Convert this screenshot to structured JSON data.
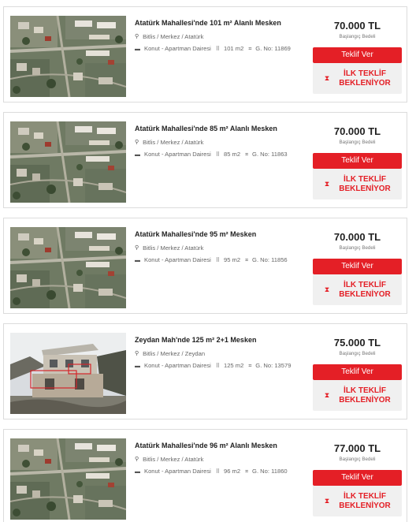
{
  "listings": [
    {
      "title": "Atatürk Mahallesi'nde 101 m² Alanlı Mesken",
      "location": "Bitlis / Merkez / Atatürk",
      "type": "Konut - Apartman Dairesi",
      "area": "101 m2",
      "gno": "G. No: 11869",
      "price": "70.000 TL",
      "price_label": "Başlangıç Bedeli",
      "bid_label": "Teklif Ver",
      "status": "İLK TEKLİF BEKLENİYOR",
      "image_kind": "aerial"
    },
    {
      "title": "Atatürk Mahallesi'nde 85 m² Alanlı Mesken",
      "location": "Bitlis / Merkez / Atatürk",
      "type": "Konut - Apartman Dairesi",
      "area": "85 m2",
      "gno": "G. No: 11863",
      "price": "70.000 TL",
      "price_label": "Başlangıç Bedeli",
      "bid_label": "Teklif Ver",
      "status": "İLK TEKLİF BEKLENİYOR",
      "image_kind": "aerial"
    },
    {
      "title": "Atatürk Mahallesi'nde 95 m² Mesken",
      "location": "Bitlis / Merkez / Atatürk",
      "type": "Konut - Apartman Dairesi",
      "area": "95 m2",
      "gno": "G. No: 11856",
      "price": "70.000 TL",
      "price_label": "Başlangıç Bedeli",
      "bid_label": "Teklif Ver",
      "status": "İLK TEKLİF BEKLENİYOR",
      "image_kind": "aerial"
    },
    {
      "title": "Zeydan Mah'nde 125 m² 2+1 Mesken",
      "location": "Bitlis / Merkez / Zeydan",
      "type": "Konut - Apartman Dairesi",
      "area": "125 m2",
      "gno": "G. No: 13579",
      "price": "75.000 TL",
      "price_label": "Başlangıç Bedeli",
      "bid_label": "Teklif Ver",
      "status": "İLK TEKLİF BEKLENİYOR",
      "image_kind": "house"
    },
    {
      "title": "Atatürk Mahallesi'nde 96 m² Alanlı Mesken",
      "location": "Bitlis / Merkez / Atatürk",
      "type": "Konut - Apartman Dairesi",
      "area": "96 m2",
      "gno": "G. No: 11860",
      "price": "77.000 TL",
      "price_label": "Başlangıç Bedeli",
      "bid_label": "Teklif Ver",
      "status": "İLK TEKLİF BEKLENİYOR",
      "image_kind": "aerial"
    }
  ],
  "icons": {
    "location": "map-pin-icon",
    "type": "building-icon",
    "area": "area-icon",
    "gno": "parcel-icon",
    "status": "hourglass-icon"
  },
  "colors": {
    "accent": "#e41f26",
    "status_bg": "#f0f0f0",
    "border": "#dcdcdc"
  }
}
